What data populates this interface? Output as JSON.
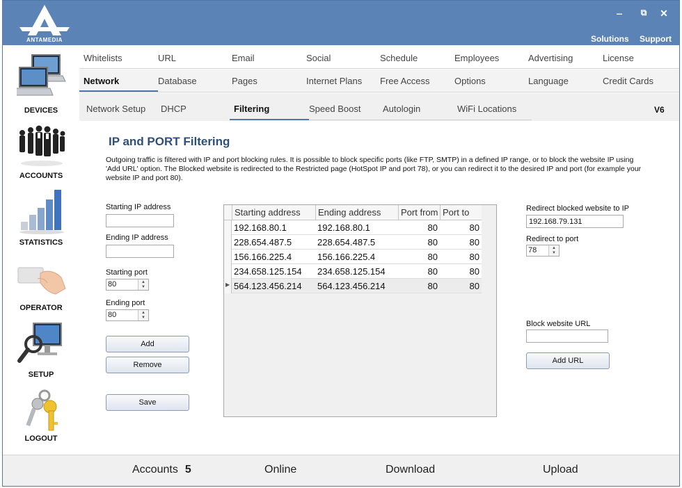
{
  "header": {
    "brand": "ANTAMEDIA",
    "links": [
      "Solutions",
      "Support"
    ],
    "window_controls": {
      "minimize": "‒",
      "restore": "⧉",
      "close": "✕"
    }
  },
  "sidebar": {
    "items": [
      {
        "label": "DEVICES",
        "icon": "devices-icon"
      },
      {
        "label": "ACCOUNTS",
        "icon": "accounts-icon"
      },
      {
        "label": "STATISTICS",
        "icon": "statistics-icon"
      },
      {
        "label": "OPERATOR",
        "icon": "operator-icon"
      },
      {
        "label": "SETUP",
        "icon": "setup-icon"
      },
      {
        "label": "LOGOUT",
        "icon": "logout-icon"
      }
    ]
  },
  "menu": {
    "row1": [
      "Whitelists",
      "URL",
      "Email",
      "Social",
      "Schedule",
      "Employees",
      "Advertising",
      "License"
    ],
    "row2": [
      "Network",
      "Database",
      "Pages",
      "Internet Plans",
      "Free Access",
      "Options",
      "Language",
      "Credit Cards"
    ],
    "active": "Network"
  },
  "subtabs": {
    "items": [
      "Network Setup",
      "DHCP",
      "Filtering",
      "Speed Boost",
      "Autologin",
      "WiFi Locations"
    ],
    "active": "Filtering",
    "version": "V6"
  },
  "page": {
    "title": "IP and PORT Filtering",
    "description": "Outgoing traffic is filtered with IP and port blocking rules. It is possible to block specific ports (like FTP, SMTP) in a defined IP range, or to block the website IP using 'Add URL' option. The Blocked website is redirected to the Restricted page (HotSpot IP and port 78), or you can redirect it to the desired IP and port (for example your website IP and port 80)."
  },
  "form": {
    "starting_ip_label": "Starting IP address",
    "starting_ip_value": "",
    "ending_ip_label": "Ending IP address",
    "ending_ip_value": "",
    "starting_port_label": "Starting port",
    "starting_port_value": "80",
    "ending_port_label": "Ending port",
    "ending_port_value": "80",
    "add_label": "Add",
    "remove_label": "Remove",
    "save_label": "Save"
  },
  "grid": {
    "columns": [
      "Starting address",
      "Ending address",
      "Port from",
      "Port to"
    ],
    "rows": [
      [
        "192.168.80.1",
        "192.168.80.1",
        "80",
        "80"
      ],
      [
        "228.654.487.5",
        "228.654.487.5",
        "80",
        "80"
      ],
      [
        "156.166.225.4",
        "156.166.225.4",
        "80",
        "80"
      ],
      [
        "234.658.125.154",
        "234.658.125.154",
        "80",
        "80"
      ],
      [
        "564.123.456.214",
        "564.123.456.214",
        "80",
        "80"
      ]
    ],
    "selected_row": 4
  },
  "redirect": {
    "ip_label": "Redirect blocked website to IP",
    "ip_value": "192.168.79.131",
    "port_label": "Redirect to port",
    "port_value": "78",
    "block_url_label": "Block website URL",
    "block_url_value": "",
    "add_url_label": "Add URL"
  },
  "status": {
    "accounts_label": "Accounts",
    "accounts_count": "5",
    "online_label": "Online",
    "download_label": "Download",
    "upload_label": "Upload"
  }
}
